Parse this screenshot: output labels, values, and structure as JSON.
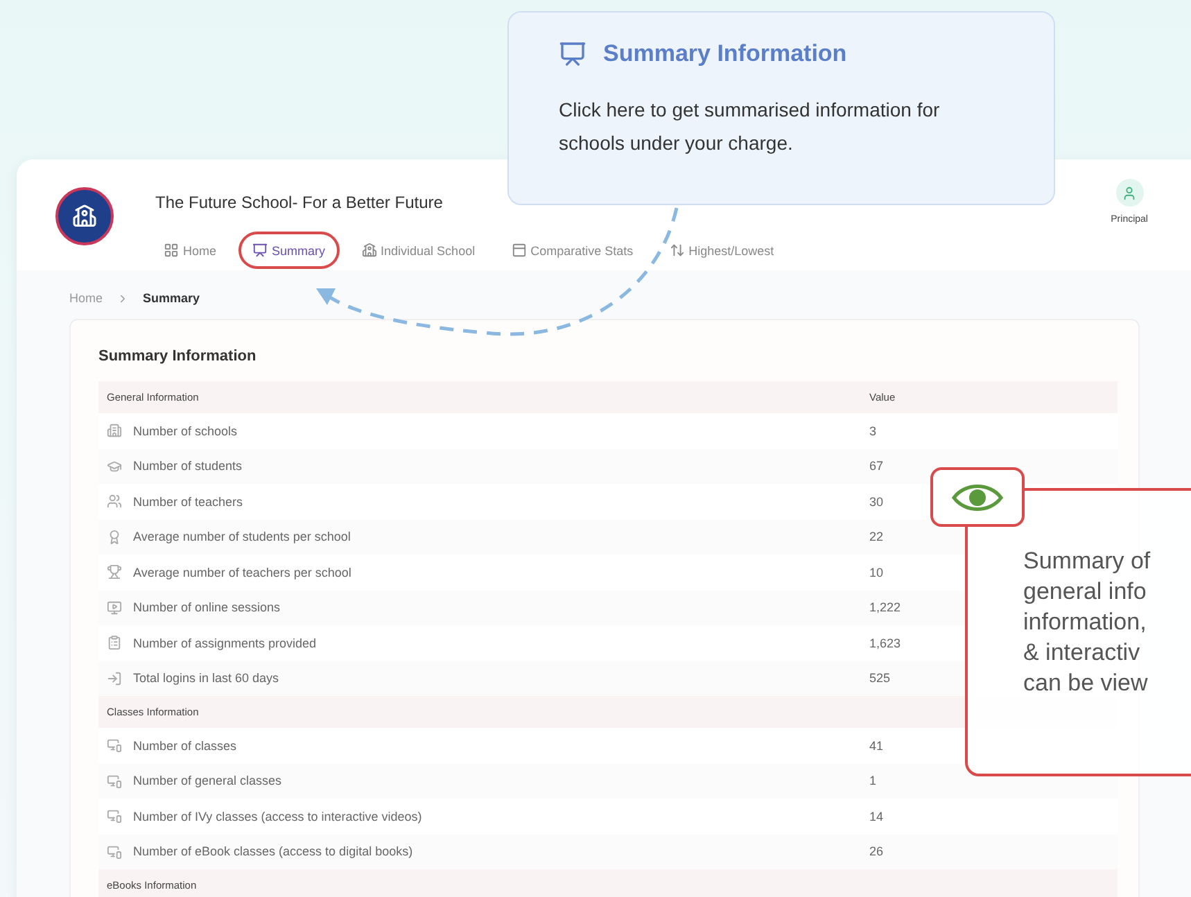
{
  "app": {
    "school_name": "The Future School- For a Better Future",
    "user_role": "Principal",
    "nav": [
      {
        "label": "Home",
        "selected": false,
        "highlighted": false
      },
      {
        "label": "Summary",
        "selected": true,
        "highlighted": true
      },
      {
        "label": "Individual School",
        "selected": false,
        "highlighted": false
      },
      {
        "label": "Comparative Stats",
        "selected": false,
        "highlighted": false
      },
      {
        "label": "Highest/Lowest",
        "selected": false,
        "highlighted": false
      }
    ],
    "breadcrumb": [
      "Home",
      "Summary"
    ],
    "panel_title": "Summary Information",
    "sections": [
      {
        "title": "General Information",
        "value_heading": "Value",
        "rows": [
          {
            "label": "Number of schools",
            "value": "3"
          },
          {
            "label": "Number of students",
            "value": "67"
          },
          {
            "label": "Number of teachers",
            "value": "30"
          },
          {
            "label": "Average number of students per school",
            "value": "22"
          },
          {
            "label": "Average number of teachers per school",
            "value": "10"
          },
          {
            "label": "Number of online sessions",
            "value": "1,222"
          },
          {
            "label": "Number of assignments provided",
            "value": "1,623"
          },
          {
            "label": "Total logins in last 60 days",
            "value": "525"
          }
        ]
      },
      {
        "title": "Classes Information",
        "rows": [
          {
            "label": "Number of classes",
            "value": "41"
          },
          {
            "label": "Number of general classes",
            "value": "1"
          },
          {
            "label": "Number of IVy classes (access to interactive videos)",
            "value": "14"
          },
          {
            "label": "Number of eBook classes (access to digital books)",
            "value": "26"
          }
        ]
      },
      {
        "title": "eBooks Information"
      }
    ]
  },
  "tooltip": {
    "title": "Summary Information",
    "text": "Click here to get summarised information for schools under your charge."
  },
  "callout": {
    "text": "Summary of\ngeneral info\ninformation,\n& interactiv\ncan be view"
  }
}
